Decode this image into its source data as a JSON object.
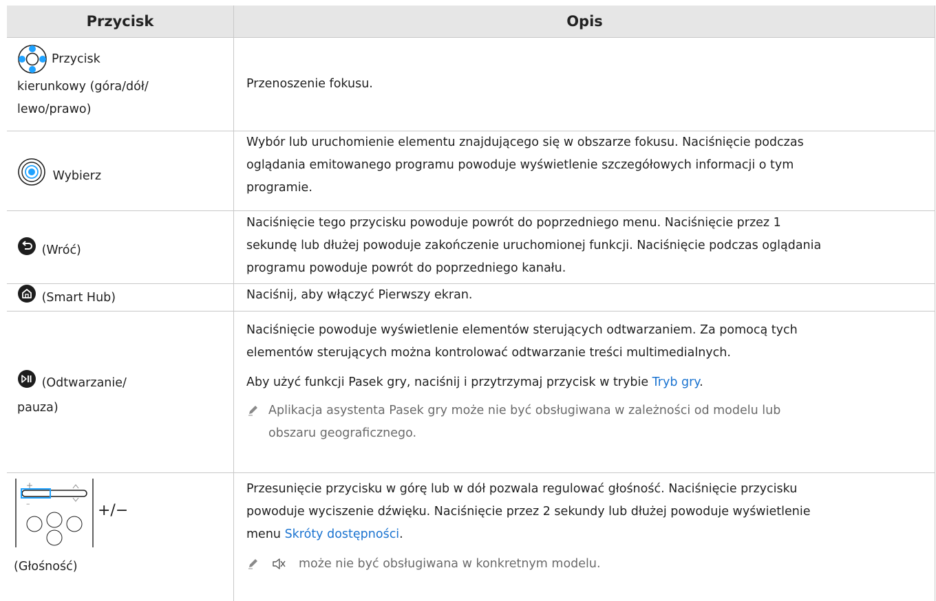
{
  "table": {
    "headers": [
      "Przycisk",
      "Opis"
    ],
    "rows": [
      {
        "button_lines": [
          "Przycisk",
          "kierunkowy (góra/dół/",
          "lewo/prawo)"
        ],
        "icon": "directional-pad-icon",
        "desc": "Przenoszenie fokusu."
      },
      {
        "button": "Wybierz",
        "icon": "select-button-icon",
        "desc_lines": [
          "Wybór lub uruchomienie elementu znajdującego się w obszarze fokusu. Naciśnięcie podczas",
          "oglądania emitowanego programu powoduje wyświetlenie szczegółowych informacji o tym",
          "programie."
        ]
      },
      {
        "button": "(Wróć)",
        "icon": "back-arrow-icon",
        "desc_lines": [
          "Naciśnięcie tego przycisku powoduje powrót do poprzedniego menu. Naciśnięcie przez 1",
          "sekundę lub dłużej powoduje zakończenie uruchomionej funkcji. Naciśnięcie podczas oglądania",
          "programu powoduje powrót do poprzedniego kanału."
        ]
      },
      {
        "button": "(Smart Hub)",
        "icon": "home-icon",
        "desc": "Naciśnij, aby włączyć Pierwszy ekran."
      },
      {
        "button_lines": [
          "(Odtwarzanie/",
          "pauza)"
        ],
        "icon": "play-pause-icon",
        "desc_lines": [
          "Naciśnięcie powoduje wyświetlenie elementów sterujących odtwarzaniem. Za pomocą tych",
          "elementów sterujących można kontrolować odtwarzanie treści multimedialnych."
        ],
        "desc2_prefix": "Aby użyć funkcji Pasek gry, naciśnij i przytrzymaj przycisk w trybie ",
        "desc2_link": "Tryb gry",
        "desc2_suffix": ".",
        "note_lines": [
          "Aplikacja asystenta Pasek gry może nie być obsługiwana w zależności od modelu lub",
          "obszaru geograficznego."
        ]
      },
      {
        "button": "(Głośność)",
        "button_suffix": "+/−",
        "icon": "volume-rocker-icon",
        "desc_lines": [
          "Przesunięcie przycisku w górę lub w dół pozwala regulować głośność. Naciśnięcie przycisku",
          "powoduje wyciszenie dźwięku. Naciśnięcie przez 2 sekundy lub dłużej powoduje wyświetlenie"
        ],
        "desc_line3_prefix": "menu ",
        "desc_line3_link": "Skróty dostępności",
        "desc_line3_suffix": ".",
        "note": "może nie być obsługiwana w konkretnym modelu.",
        "note_icon": "mute-icon"
      }
    ]
  },
  "colors": {
    "header_bg": "#e6e6e6",
    "link": "#1a73d0",
    "icon_blue": "#1fa2ff",
    "icon_dark": "#1d1d1d"
  }
}
